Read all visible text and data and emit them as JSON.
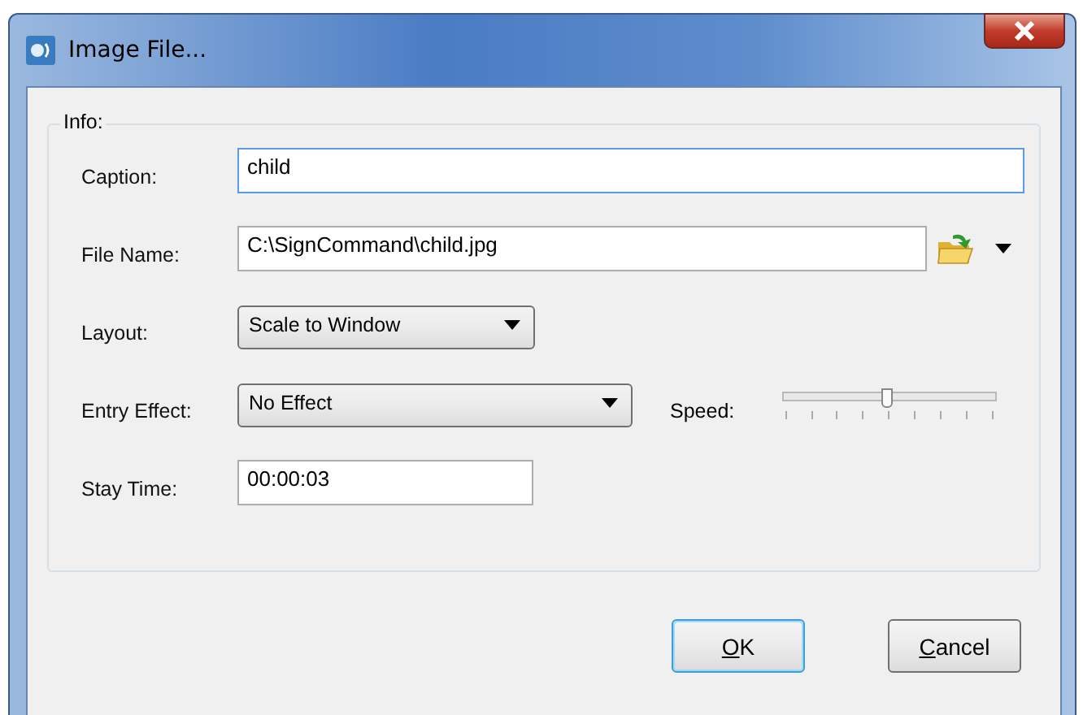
{
  "window": {
    "title": "Image File..."
  },
  "group": {
    "label": "Info:"
  },
  "caption": {
    "label": "Caption:",
    "value": "child"
  },
  "file_name": {
    "label": "File Name:",
    "value": "C:\\SignCommand\\child.jpg"
  },
  "layout": {
    "label": "Layout:",
    "value": "Scale to Window"
  },
  "entry_effect": {
    "label": "Entry Effect:",
    "value": "No Effect"
  },
  "speed": {
    "label": "Speed:",
    "level": 0.48
  },
  "stay_time": {
    "label": "Stay Time:",
    "value": "00:00:03"
  },
  "buttons": [
    {
      "label": "OK",
      "default": true
    },
    {
      "label": "Cancel",
      "default": false
    }
  ]
}
